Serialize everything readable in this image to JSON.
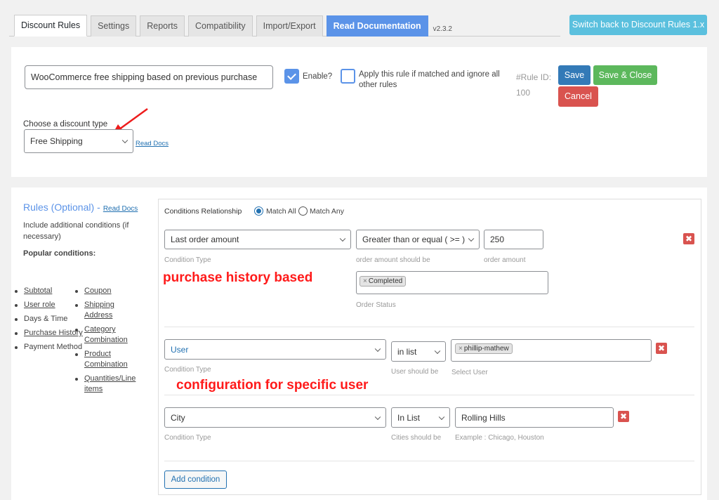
{
  "tabs": [
    {
      "label": "Discount Rules",
      "active": true
    },
    {
      "label": "Settings",
      "active": false
    },
    {
      "label": "Reports",
      "active": false
    },
    {
      "label": "Compatibility",
      "active": false
    },
    {
      "label": "Import/Export",
      "active": false
    },
    {
      "label": "Read Documentation",
      "active": false
    }
  ],
  "version": "v2.3.2",
  "switch_button": "Switch back to Discount Rules 1.x",
  "rule": {
    "title_value": "WooCommerce free shipping based on previous purchase",
    "enable_label": "Enable?",
    "enable_checked": true,
    "apply_label": "Apply this rule if matched and ignore all other rules",
    "apply_checked": false,
    "rule_id_label": "#Rule ID:",
    "rule_id_value": "100",
    "save": "Save",
    "save_close": "Save & Close",
    "cancel": "Cancel",
    "discount_type_label": "Choose a discount type",
    "discount_type_value": "Free Shipping",
    "read_docs": "Read Docs"
  },
  "sidebar": {
    "title": "Rules (Optional)",
    "dash": "-",
    "read_docs": "Read Docs",
    "description": "Include additional conditions (if necessary)",
    "popular_label": "Popular conditions:",
    "col1": [
      {
        "label": "Subtotal",
        "link": true
      },
      {
        "label": "User role",
        "link": true
      },
      {
        "label": "Days & Time",
        "link": false
      },
      {
        "label": "Purchase History",
        "link": true
      },
      {
        "label": "Payment Method",
        "link": false
      }
    ],
    "col2": [
      {
        "label": "Coupon",
        "link": true
      },
      {
        "label": "Shipping Address",
        "link": true
      },
      {
        "label": "Category Combination",
        "link": true
      },
      {
        "label": "Product Combination",
        "link": true
      },
      {
        "label": "Quantities/Line items",
        "link": true
      }
    ]
  },
  "conditions": {
    "relationship_label": "Conditions Relationship",
    "match_all": "Match All",
    "match_any": "Match Any",
    "selected": "Match All",
    "rows": [
      {
        "type": "Last order amount",
        "type_hint": "Condition Type",
        "operator": "Greater than or equal ( >= )",
        "operator_hint": "order amount should be",
        "value": "250",
        "value_hint": "order amount",
        "status_tag": "Completed",
        "status_hint": "Order Status"
      },
      {
        "type": "User",
        "type_hint": "Condition Type",
        "operator": "in list",
        "operator_hint": "User should be",
        "tag": "phillip-mathew",
        "value_hint": "Select User"
      },
      {
        "type": "City",
        "type_hint": "Condition Type",
        "operator": "In List",
        "operator_hint": "Cities should be",
        "value": "Rolling Hills",
        "value_hint": "Example : Chicago, Houston"
      }
    ],
    "add_button": "Add condition"
  },
  "annotations": {
    "purchase_history": "purchase history based",
    "specific_user": "configuration for specific user"
  },
  "tag_remove": "×",
  "delete_glyph": "✖"
}
